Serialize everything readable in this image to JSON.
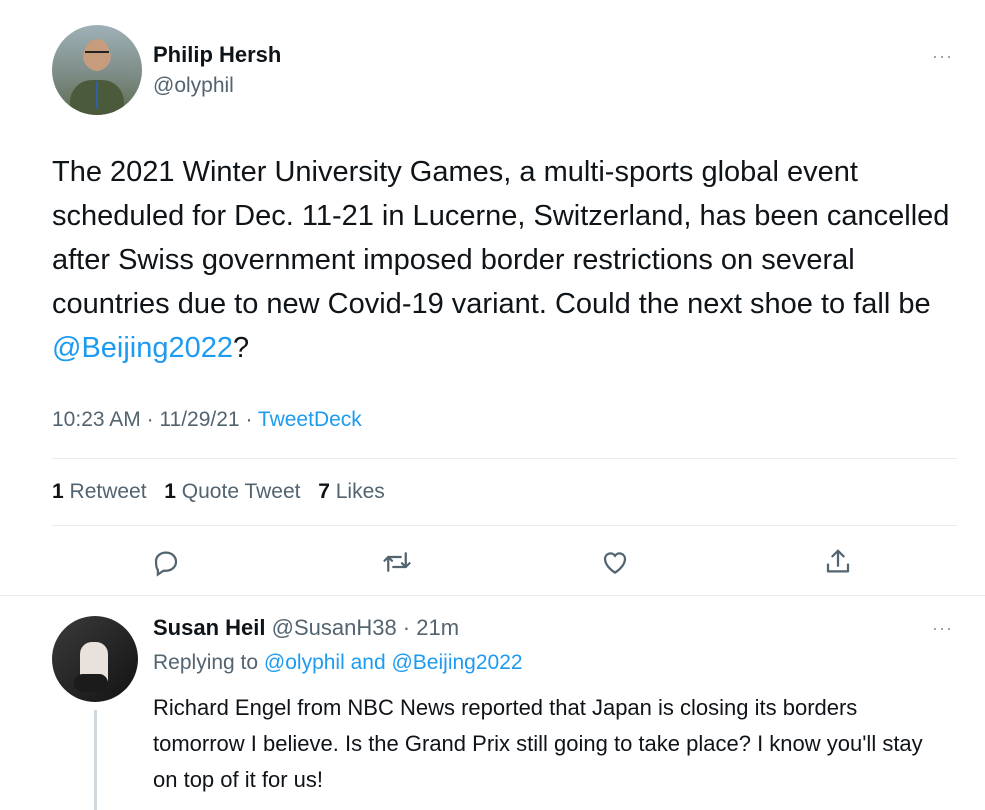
{
  "tweet": {
    "author_name": "Philip Hersh",
    "author_handle": "@olyphil",
    "text_before": "The 2021 Winter University Games, a multi-sports global event scheduled for Dec. 11-21 in Lucerne, Switzerland, has been cancelled after Swiss government imposed border restrictions on several countries due to new Covid-19 variant. Could the next shoe to fall be ",
    "mention": "@Beijing2022",
    "text_after": "?",
    "time": "10:23 AM",
    "date": "11/29/21",
    "source": "TweetDeck",
    "more_label": "···",
    "stats": {
      "retweets_count": "1",
      "retweets_label": "Retweet",
      "quotes_count": "1",
      "quotes_label": "Quote Tweet",
      "likes_count": "7",
      "likes_label": "Likes"
    }
  },
  "actions": {
    "reply_icon": "reply-icon",
    "retweet_icon": "retweet-icon",
    "like_icon": "heart-icon",
    "share_icon": "share-icon"
  },
  "reply": {
    "author_name": "Susan Heil",
    "author_handle": "@SusanH38",
    "time": "21m",
    "replying_prefix": "Replying to ",
    "replying_user1": "@olyphil",
    "replying_and": " and ",
    "replying_user2": "@Beijing2022",
    "text": "Richard Engel from NBC News reported that Japan is closing its borders tomorrow I believe. Is the Grand Prix still going to take place? I know you'll stay on top of it for us!",
    "more_label": "···"
  },
  "colors": {
    "accent": "#1d9bf0",
    "secondary_text": "#536471",
    "divider": "#e6ecf0"
  }
}
